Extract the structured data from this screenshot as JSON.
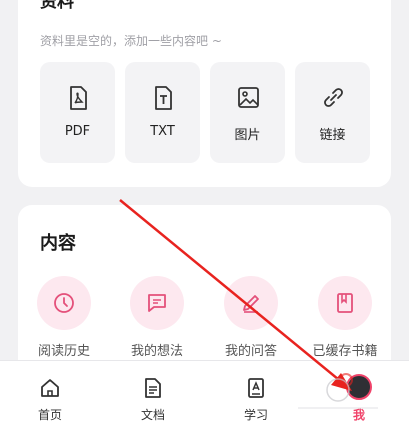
{
  "materials": {
    "title": "资料",
    "hint": "资料里是空的，添加一些内容吧 ~",
    "chevron": "›",
    "tiles": [
      {
        "label": "PDF",
        "icon": "pdf-icon"
      },
      {
        "label": "TXT",
        "icon": "txt-icon"
      },
      {
        "label": "图片",
        "icon": "image-icon"
      },
      {
        "label": "链接",
        "icon": "link-icon"
      }
    ]
  },
  "content": {
    "title": "内容",
    "entries": [
      {
        "label": "阅读历史",
        "icon": "clock-icon"
      },
      {
        "label": "我的想法",
        "icon": "thought-icon"
      },
      {
        "label": "我的问答",
        "icon": "pencil-icon"
      },
      {
        "label": "已缓存书籍",
        "icon": "book-icon"
      }
    ]
  },
  "nav": {
    "items": [
      {
        "label": "首页",
        "icon": "home-icon"
      },
      {
        "label": "文档",
        "icon": "document-icon"
      },
      {
        "label": "学习",
        "icon": "study-icon"
      },
      {
        "label": "我",
        "icon": "avatar"
      }
    ]
  },
  "colors": {
    "accent": "#f0436a",
    "tile_bg": "#f3f3f5",
    "entry_bg": "#fde8ef",
    "arrow": "#e8231f"
  }
}
